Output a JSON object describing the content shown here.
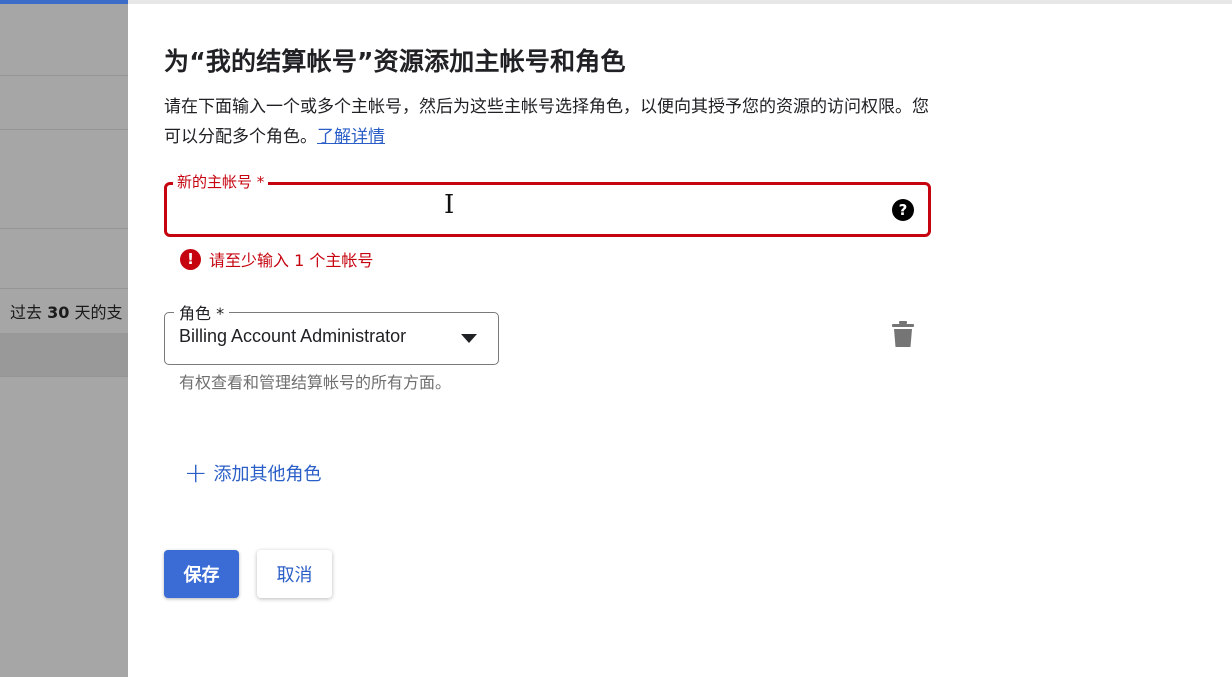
{
  "background": {
    "row_text_prefix": "过去",
    "row_text_number": "30",
    "row_text_suffix": "天的支"
  },
  "dialog": {
    "title": "为“我的结算帐号”资源添加主帐号和角色",
    "description": "请在下面输入一个或多个主帐号，然后为这些主帐号选择角色，以便向其授予您的资源的访问权限。您可以分配多个角色。",
    "learn_more": "了解详情"
  },
  "principal_field": {
    "label": "新的主帐号 *",
    "value": "",
    "help_icon": "help-circle-icon",
    "error_text": "请至少输入 1 个主帐号",
    "error_icon": "error-icon"
  },
  "role_field": {
    "label": "角色 *",
    "value": "Billing Account Administrator",
    "description": "有权查看和管理结算帐号的所有方面。",
    "delete_icon": "trash-icon"
  },
  "add_role": {
    "label": "添加其他角色",
    "icon": "plus-icon"
  },
  "actions": {
    "save": "保存",
    "cancel": "取消"
  },
  "colors": {
    "error": "#c5040f",
    "primary": "#3b6cd6",
    "link": "#2b5fc7"
  }
}
